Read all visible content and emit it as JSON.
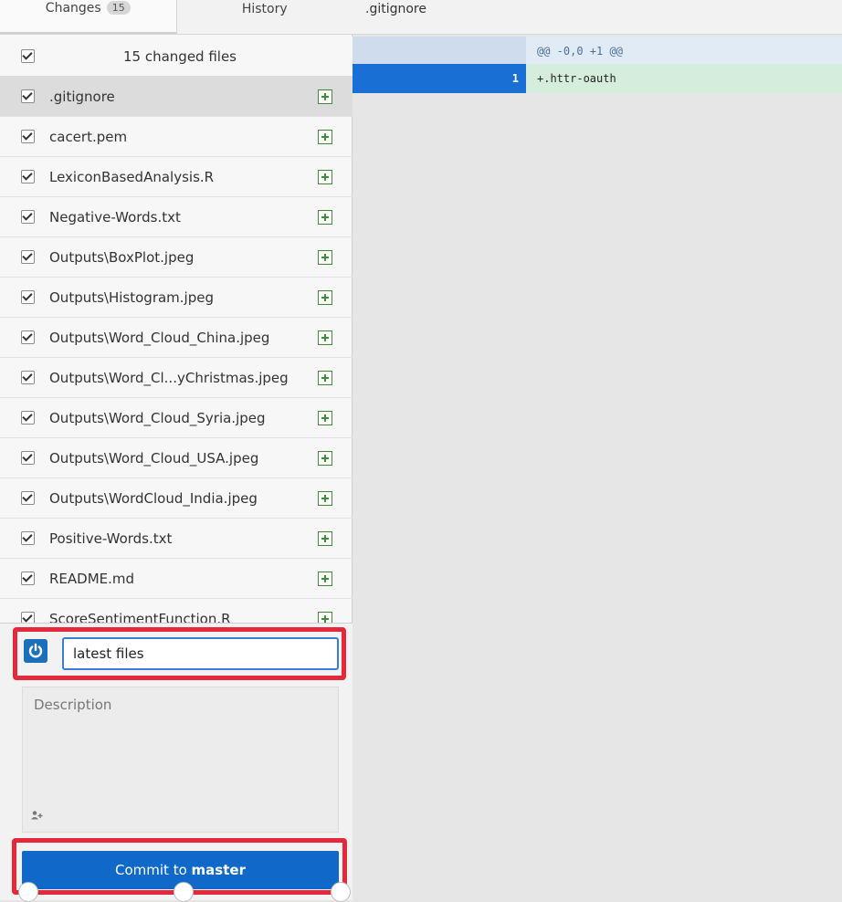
{
  "tabs": {
    "changes_label": "Changes",
    "changes_count": "15",
    "history_label": "History"
  },
  "summary": {
    "label": "15 changed files"
  },
  "files": [
    {
      "name": ".gitignore",
      "status": "added",
      "selected": true
    },
    {
      "name": "cacert.pem",
      "status": "added"
    },
    {
      "name": "LexiconBasedAnalysis.R",
      "status": "added"
    },
    {
      "name": "Negative-Words.txt",
      "status": "added"
    },
    {
      "name": "Outputs\\BoxPlot.jpeg",
      "status": "added"
    },
    {
      "name": "Outputs\\Histogram.jpeg",
      "status": "added"
    },
    {
      "name": "Outputs\\Word_Cloud_China.jpeg",
      "status": "added"
    },
    {
      "name": "Outputs\\Word_Cl...yChristmas.jpeg",
      "status": "added"
    },
    {
      "name": "Outputs\\Word_Cloud_Syria.jpeg",
      "status": "added"
    },
    {
      "name": "Outputs\\Word_Cloud_USA.jpeg",
      "status": "added"
    },
    {
      "name": "Outputs\\WordCloud_India.jpeg",
      "status": "added"
    },
    {
      "name": "Positive-Words.txt",
      "status": "added"
    },
    {
      "name": "README.md",
      "status": "added"
    },
    {
      "name": "ScoreSentimentFunction.R",
      "status": "added"
    }
  ],
  "commit": {
    "summary_value": "latest files",
    "description_placeholder": "Description",
    "button_prefix": "Commit to ",
    "branch": "master"
  },
  "diff": {
    "file_title": ".gitignore",
    "hunk_header": "@@ -0,0 +1 @@",
    "lines": [
      {
        "new_line_no": "1",
        "text": "+.httr-oauth"
      }
    ]
  },
  "colors": {
    "accent": "#1068c9",
    "added_icon": "#3c8c3c",
    "highlight_frame": "#e5293c",
    "diff_added_bg": "#d5eedb"
  },
  "icons": {
    "checkbox": "checkbox-checked-icon",
    "file_status": "file-added-icon",
    "avatar": "power-icon",
    "coauthor": "add-coauthor-icon"
  }
}
